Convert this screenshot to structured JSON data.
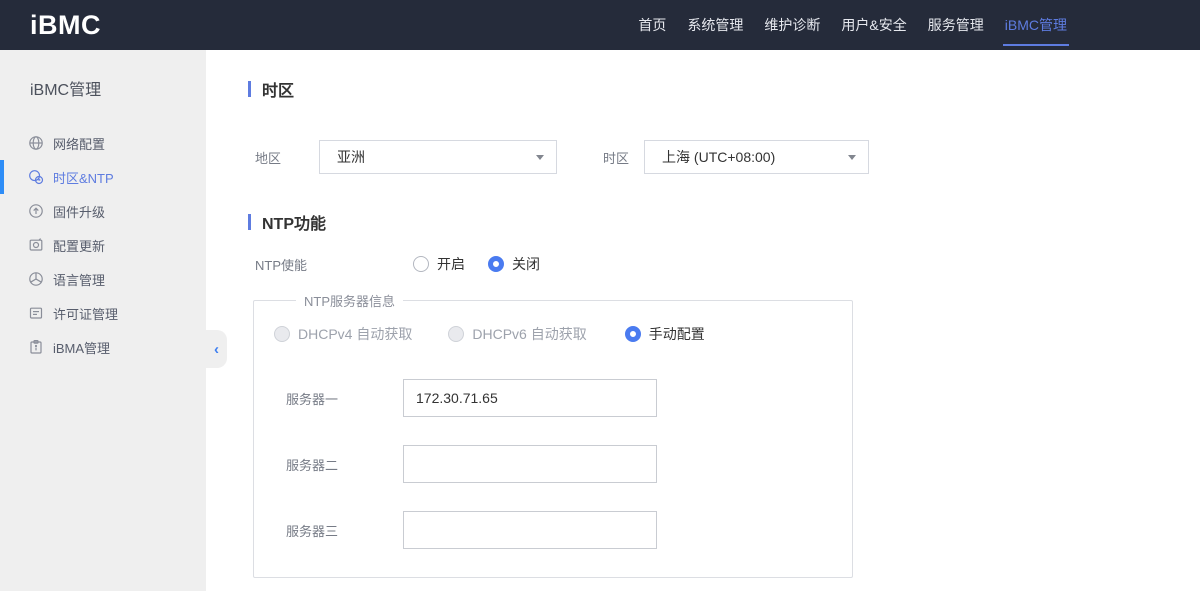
{
  "header": {
    "logo": "iBMC",
    "nav": [
      {
        "label": "首页",
        "active": false
      },
      {
        "label": "系统管理",
        "active": false
      },
      {
        "label": "维护诊断",
        "active": false
      },
      {
        "label": "用户&安全",
        "active": false
      },
      {
        "label": "服务管理",
        "active": false
      },
      {
        "label": "iBMC管理",
        "active": true
      }
    ]
  },
  "sidebar": {
    "title": "iBMC管理",
    "collapse_icon": "‹",
    "items": [
      {
        "label": "网络配置",
        "icon": "network-icon",
        "active": false
      },
      {
        "label": "时区&NTP",
        "icon": "timezone-icon",
        "active": true
      },
      {
        "label": "固件升级",
        "icon": "firmware-upgrade-icon",
        "active": false
      },
      {
        "label": "配置更新",
        "icon": "config-update-icon",
        "active": false
      },
      {
        "label": "语言管理",
        "icon": "language-icon",
        "active": false
      },
      {
        "label": "许可证管理",
        "icon": "license-icon",
        "active": false
      },
      {
        "label": "iBMA管理",
        "icon": "ibma-icon",
        "active": false
      }
    ]
  },
  "timezone": {
    "title": "时区",
    "region_label": "地区",
    "region_value": "亚洲",
    "zone_label": "时区",
    "zone_value": "上海 (UTC+08:00)"
  },
  "ntp": {
    "title": "NTP功能",
    "enable_label": "NTP使能",
    "on_label": "开启",
    "off_label": "关闭",
    "enable_selected": "关闭",
    "group_legend": "NTP服务器信息",
    "dhcp4_label": "DHCPv4 自动获取",
    "dhcp6_label": "DHCPv6 自动获取",
    "manual_label": "手动配置",
    "mode_selected": "手动配置",
    "servers": [
      {
        "label": "服务器一",
        "value": "172.30.71.65"
      },
      {
        "label": "服务器二",
        "value": ""
      },
      {
        "label": "服务器三",
        "value": ""
      }
    ]
  },
  "colors": {
    "header_bg": "#252b3a",
    "accent_blue": "#5e7ce0",
    "active_bar_blue": "#2e8df7",
    "radio_blue": "#4a7bf0",
    "sidebar_bg": "#efefef"
  }
}
